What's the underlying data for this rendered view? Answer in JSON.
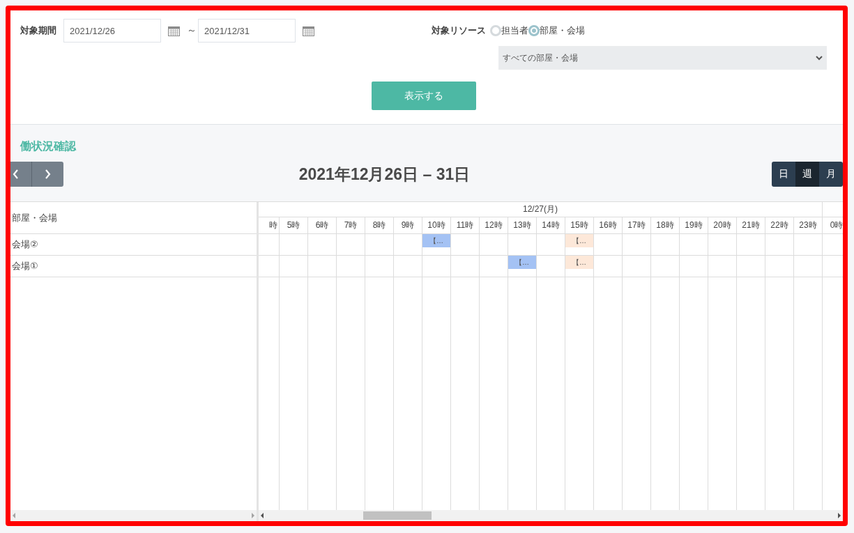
{
  "filter": {
    "period_label": "対象期間",
    "start_date": "2021/12/26",
    "separator": "～",
    "end_date": "2021/12/31",
    "resource_label": "対象リソース",
    "resource_options": [
      {
        "label": "担当者",
        "selected": false
      },
      {
        "label": "部屋・会場",
        "selected": true
      }
    ],
    "resource_select": "すべての部屋・会場",
    "submit_button": "表示する"
  },
  "schedule": {
    "title": "働状況確認",
    "range_title": "2021年12月26日 – 31日",
    "views": [
      {
        "label": "日",
        "selected": false
      },
      {
        "label": "週",
        "selected": true
      },
      {
        "label": "月",
        "selected": false
      }
    ],
    "resource_header": "部屋・会場",
    "day_header": "12/27(月)",
    "hours": [
      "時",
      "5時",
      "6時",
      "7時",
      "8時",
      "9時",
      "10時",
      "11時",
      "12時",
      "13時",
      "14時",
      "15時",
      "16時",
      "17時",
      "18時",
      "19時",
      "20時",
      "21時",
      "22時",
      "23時",
      "0時"
    ],
    "rows": [
      {
        "name": "会場②",
        "cells": [
          null,
          null,
          null,
          null,
          null,
          null,
          {
            "label": "【…",
            "color": "#a4c2f4"
          },
          null,
          null,
          null,
          null,
          {
            "label": "【…",
            "color": "#fde8d9"
          },
          null,
          null,
          null,
          null,
          null,
          null,
          null,
          null,
          null
        ]
      },
      {
        "name": "会場①",
        "cells": [
          null,
          null,
          null,
          null,
          null,
          null,
          null,
          null,
          null,
          {
            "label": "【…",
            "color": "#a4c2f4"
          },
          null,
          {
            "label": "【…",
            "color": "#fde8d9"
          },
          null,
          null,
          null,
          null,
          null,
          null,
          null,
          null,
          null
        ]
      }
    ]
  }
}
